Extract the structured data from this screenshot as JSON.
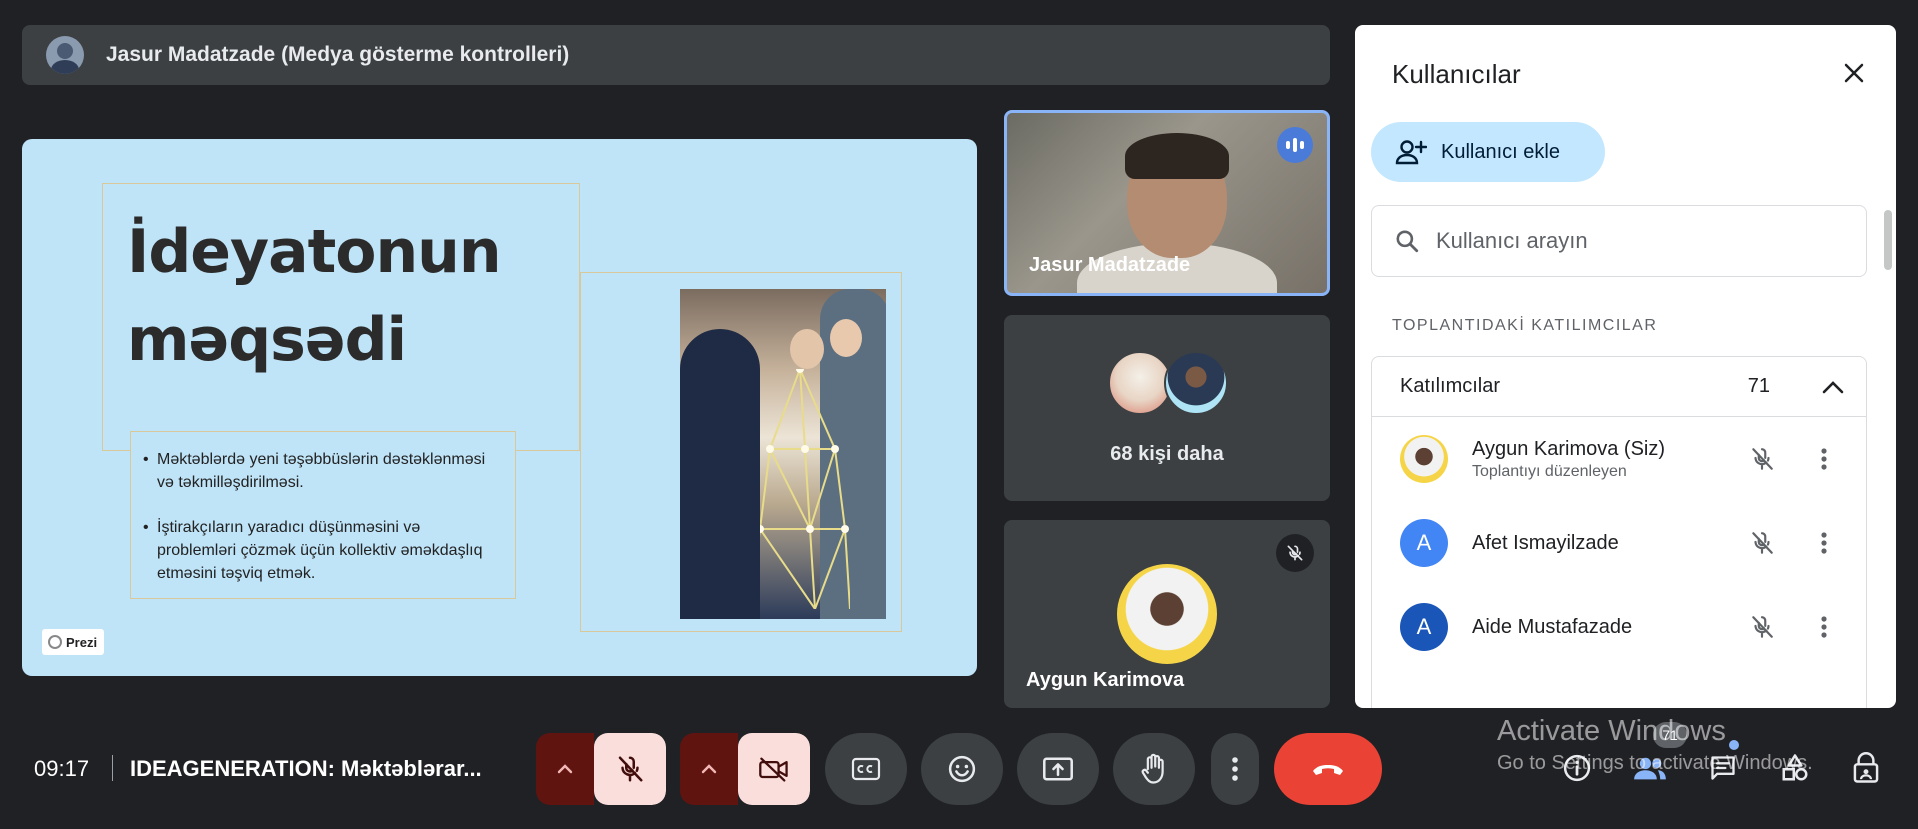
{
  "presenter_bar": {
    "name": "Jasur Madatzade (Medya gösterme kontrolleri)"
  },
  "slide": {
    "title_line1": "İdeyatonun",
    "title_line2": "məqsədi",
    "bullets": [
      "Məktəblərdə yeni təşəbbüslərin dəstəklənməsi və təkmilləşdirilməsi.",
      "İştirakçıların yaradıcı düşünməsini və problemləri çözmək üçün kollektiv əməkdaşlıq etməsini təşviq etmək."
    ],
    "badge": "Prezi"
  },
  "tiles": {
    "speaker": {
      "name": "Jasur Madatzade"
    },
    "more": {
      "label": "68 kişi daha"
    },
    "self": {
      "name": "Aygun Karimova"
    }
  },
  "panel": {
    "title": "Kullanıcılar",
    "add_button": "Kullanıcı ekle",
    "search_placeholder": "Kullanıcı arayın",
    "section_label": "TOPLANTIDAKİ KATILIMCILAR",
    "group": {
      "label": "Katılımcılar",
      "count": "71"
    },
    "participants": [
      {
        "name": "Aygun Karimova (Siz)",
        "sub": "Toplantıyı düzenleyen",
        "initial": "",
        "color": "#f5d547"
      },
      {
        "name": "Afet Ismayilzade",
        "sub": "",
        "initial": "A",
        "color": "#4285f4"
      },
      {
        "name": "Aide Mustafazade",
        "sub": "",
        "initial": "A",
        "color": "#1a56b8"
      }
    ]
  },
  "bottom_bar": {
    "time": "09:17",
    "meeting_name": "IDEAGENERATION: Məktəblərar...",
    "people_count": "71"
  },
  "watermark": {
    "line1": "Activate Windows",
    "line2": "Go to Settings to activate Windows."
  }
}
